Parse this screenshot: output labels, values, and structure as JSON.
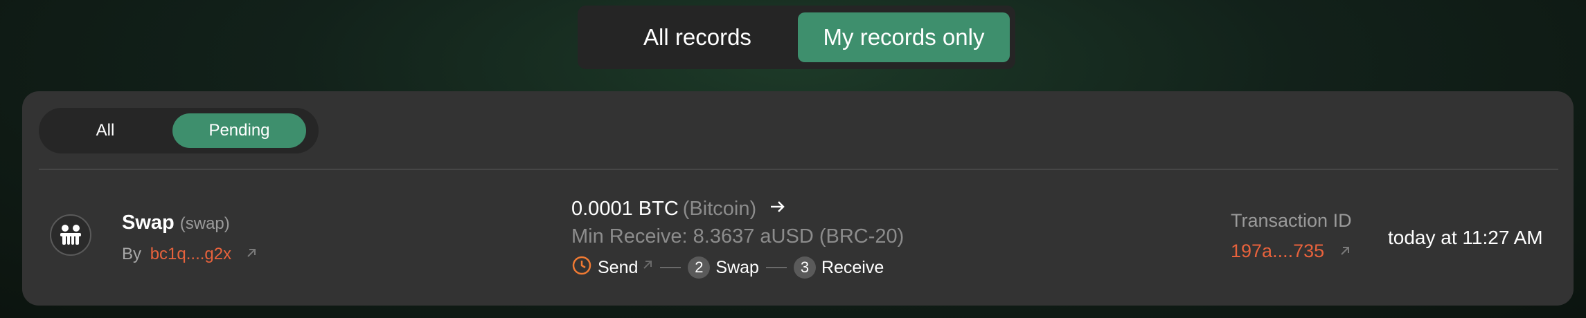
{
  "top_toggle": {
    "all_label": "All records",
    "mine_label": "My records only",
    "selected": "My records only"
  },
  "filter": {
    "all_label": "All",
    "pending_label": "Pending",
    "selected": "Pending"
  },
  "record": {
    "title": "Swap",
    "type": "(swap)",
    "by_label": "By",
    "address": "bc1q....g2x",
    "amount": "0.0001 BTC",
    "chain": "(Bitcoin)",
    "min_receive": "Min Receive: 8.3637 aUSD (BRC-20)",
    "steps": [
      {
        "num": "1",
        "label": "Send"
      },
      {
        "num": "2",
        "label": "Swap"
      },
      {
        "num": "3",
        "label": "Receive"
      }
    ],
    "tx_label": "Transaction ID",
    "tx_id": "197a....735",
    "time": "today at 11:27 AM"
  },
  "colors": {
    "accent": "#3e8f6d",
    "link": "#e8623c",
    "card": "#333333",
    "pending": "#f07a33"
  },
  "icons": [
    "people-icon",
    "external-link-icon",
    "arrow-right-icon",
    "clock-icon"
  ]
}
